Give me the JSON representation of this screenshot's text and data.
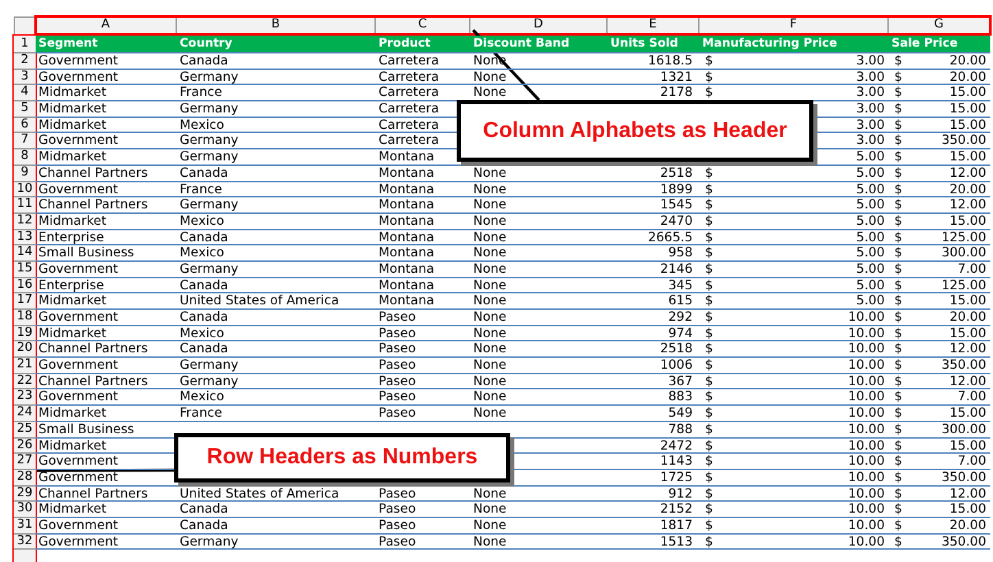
{
  "columns": [
    "A",
    "B",
    "C",
    "D",
    "E",
    "F",
    "G"
  ],
  "header_row": {
    "num": "1",
    "labels": [
      "Segment",
      "Country",
      "Product",
      "Discount Band",
      "Units Sold",
      "Manufacturing Price",
      "Sale Price"
    ]
  },
  "rows": [
    {
      "num": "2",
      "cells": [
        "Government",
        "Canada",
        "Carretera",
        "None",
        "1618.5",
        "$",
        "3.00",
        "$",
        "20.00"
      ]
    },
    {
      "num": "3",
      "cells": [
        "Government",
        "Germany",
        "Carretera",
        "None",
        "1321",
        "$",
        "3.00",
        "$",
        "20.00"
      ]
    },
    {
      "num": "4",
      "cells": [
        "Midmarket",
        "France",
        "Carretera",
        "None",
        "2178",
        "$",
        "3.00",
        "$",
        "15.00"
      ]
    },
    {
      "num": "5",
      "cells": [
        "Midmarket",
        "Germany",
        "Carretera",
        null,
        null,
        null,
        "3.00",
        "$",
        "15.00"
      ]
    },
    {
      "num": "6",
      "cells": [
        "Midmarket",
        "Mexico",
        "Carretera",
        null,
        null,
        null,
        "3.00",
        "$",
        "15.00"
      ]
    },
    {
      "num": "7",
      "cells": [
        "Government",
        "Germany",
        "Carretera",
        null,
        null,
        null,
        "3.00",
        "$",
        "350.00"
      ]
    },
    {
      "num": "8",
      "cells": [
        "Midmarket",
        "Germany",
        "Montana",
        null,
        null,
        null,
        "5.00",
        "$",
        "15.00"
      ]
    },
    {
      "num": "9",
      "cells": [
        "Channel Partners",
        "Canada",
        "Montana",
        "None",
        "2518",
        "$",
        "5.00",
        "$",
        "12.00"
      ]
    },
    {
      "num": "10",
      "cells": [
        "Government",
        "France",
        "Montana",
        "None",
        "1899",
        "$",
        "5.00",
        "$",
        "20.00"
      ]
    },
    {
      "num": "11",
      "cells": [
        "Channel Partners",
        "Germany",
        "Montana",
        "None",
        "1545",
        "$",
        "5.00",
        "$",
        "12.00"
      ]
    },
    {
      "num": "12",
      "cells": [
        "Midmarket",
        "Mexico",
        "Montana",
        "None",
        "2470",
        "$",
        "5.00",
        "$",
        "15.00"
      ]
    },
    {
      "num": "13",
      "cells": [
        "Enterprise",
        "Canada",
        "Montana",
        "None",
        "2665.5",
        "$",
        "5.00",
        "$",
        "125.00"
      ]
    },
    {
      "num": "14",
      "cells": [
        "Small Business",
        "Mexico",
        "Montana",
        "None",
        "958",
        "$",
        "5.00",
        "$",
        "300.00"
      ]
    },
    {
      "num": "15",
      "cells": [
        "Government",
        "Germany",
        "Montana",
        "None",
        "2146",
        "$",
        "5.00",
        "$",
        "7.00"
      ]
    },
    {
      "num": "16",
      "cells": [
        "Enterprise",
        "Canada",
        "Montana",
        "None",
        "345",
        "$",
        "5.00",
        "$",
        "125.00"
      ]
    },
    {
      "num": "17",
      "cells": [
        "Midmarket",
        "United States of America",
        "Montana",
        "None",
        "615",
        "$",
        "5.00",
        "$",
        "15.00"
      ]
    },
    {
      "num": "18",
      "cells": [
        "Government",
        "Canada",
        "Paseo",
        "None",
        "292",
        "$",
        "10.00",
        "$",
        "20.00"
      ]
    },
    {
      "num": "19",
      "cells": [
        "Midmarket",
        "Mexico",
        "Paseo",
        "None",
        "974",
        "$",
        "10.00",
        "$",
        "15.00"
      ]
    },
    {
      "num": "20",
      "cells": [
        "Channel Partners",
        "Canada",
        "Paseo",
        "None",
        "2518",
        "$",
        "10.00",
        "$",
        "12.00"
      ]
    },
    {
      "num": "21",
      "cells": [
        "Government",
        "Germany",
        "Paseo",
        "None",
        "1006",
        "$",
        "10.00",
        "$",
        "350.00"
      ]
    },
    {
      "num": "22",
      "cells": [
        "Channel Partners",
        "Germany",
        "Paseo",
        "None",
        "367",
        "$",
        "10.00",
        "$",
        "12.00"
      ]
    },
    {
      "num": "23",
      "cells": [
        "Government",
        "Mexico",
        "Paseo",
        "None",
        "883",
        "$",
        "10.00",
        "$",
        "7.00"
      ]
    },
    {
      "num": "24",
      "cells": [
        "Midmarket",
        "France",
        "Paseo",
        "None",
        "549",
        "$",
        "10.00",
        "$",
        "15.00"
      ]
    },
    {
      "num": "25",
      "cells": [
        "Small Business",
        null,
        null,
        null,
        "788",
        "$",
        "10.00",
        "$",
        "300.00"
      ]
    },
    {
      "num": "26",
      "cells": [
        "Midmarket",
        null,
        null,
        null,
        "2472",
        "$",
        "10.00",
        "$",
        "15.00"
      ]
    },
    {
      "num": "27",
      "cells": [
        "Government",
        null,
        null,
        null,
        "1143",
        "$",
        "10.00",
        "$",
        "7.00"
      ]
    },
    {
      "num": "28",
      "cells": [
        "Government",
        null,
        null,
        null,
        "1725",
        "$",
        "10.00",
        "$",
        "350.00"
      ]
    },
    {
      "num": "29",
      "cells": [
        "Channel Partners",
        "United States of America",
        "Paseo",
        "None",
        "912",
        "$",
        "10.00",
        "$",
        "12.00"
      ]
    },
    {
      "num": "30",
      "cells": [
        "Midmarket",
        "Canada",
        "Paseo",
        "None",
        "2152",
        "$",
        "10.00",
        "$",
        "15.00"
      ]
    },
    {
      "num": "31",
      "cells": [
        "Government",
        "Canada",
        "Paseo",
        "None",
        "1817",
        "$",
        "10.00",
        "$",
        "20.00"
      ]
    },
    {
      "num": "32",
      "cells": [
        "Government",
        "Germany",
        "Paseo",
        "None",
        "1513",
        "$",
        "10.00",
        "$",
        "350.00"
      ]
    }
  ],
  "callouts": [
    {
      "text": "Column Alphabets as Header"
    },
    {
      "text": "Row Headers as Numbers"
    }
  ]
}
